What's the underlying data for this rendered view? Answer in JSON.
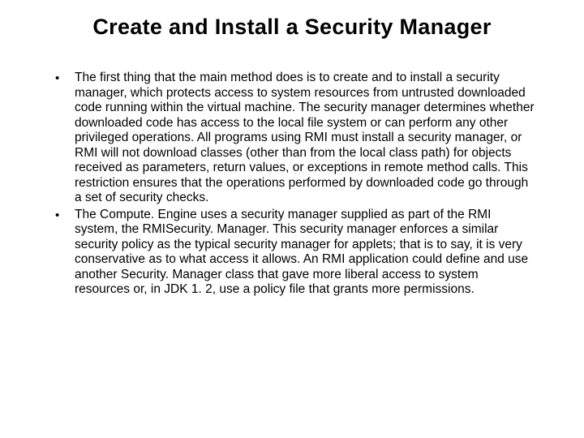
{
  "title": "Create and Install a Security Manager",
  "bullets": [
    {
      "marker": "•",
      "text": "The first thing that the main method does is to create and to install a security manager, which protects access to system resources from untrusted downloaded code running within the virtual machine. The security manager determines whether downloaded code has access to the local file system or can perform any other privileged operations. All programs using RMI must install a security manager, or RMI will not download classes (other than from the local class path) for objects received as parameters, return values, or exceptions in remote method calls. This restriction ensures that the operations performed by downloaded code go through a set of security checks."
    },
    {
      "marker": "•",
      "text": "The Compute. Engine uses a security manager supplied as part of the RMI system, the RMISecurity. Manager. This security manager enforces a similar security policy as the typical security manager for applets; that is to say, it is very conservative as to what access it allows. An RMI application could define and use another Security. Manager class that gave more liberal access to system resources or, in JDK 1. 2, use a policy file that grants more permissions."
    }
  ]
}
